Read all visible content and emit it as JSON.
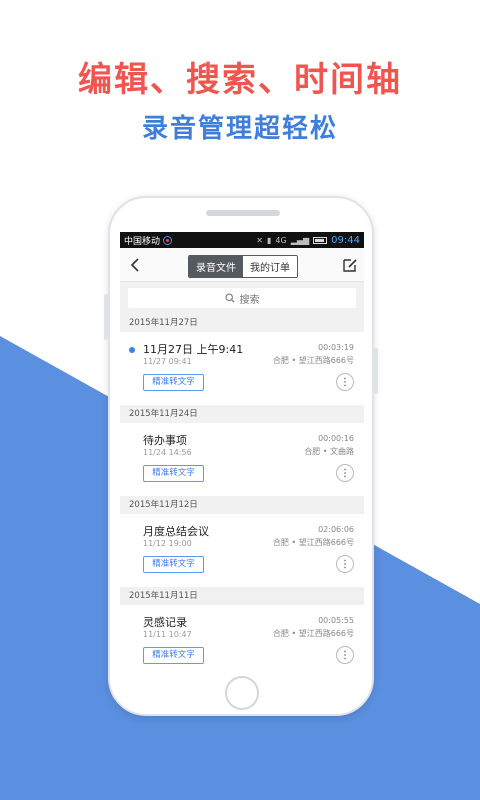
{
  "promo": {
    "headline": "编辑、搜索、时间轴",
    "subline": "录音管理超轻松"
  },
  "colors": {
    "headline": "#f0564f",
    "subline": "#3f7fdc",
    "background_triangle": "#5b8fdf",
    "accent": "#3b82f6"
  },
  "statusbar": {
    "carrier": "中国移动",
    "network": "4G",
    "time": "09:44"
  },
  "navbar": {
    "back_icon": "chevron-left-icon",
    "tabs": [
      {
        "label": "录音文件",
        "active": true
      },
      {
        "label": "我的订单",
        "active": false
      }
    ],
    "edit_icon": "edit-icon"
  },
  "search": {
    "placeholder": "搜索"
  },
  "groups": [
    {
      "date": "2015年11月27日",
      "items": [
        {
          "title": "11月27日 上午9:41",
          "meta": "11/27  09:41",
          "duration": "00:03:19",
          "location": "合肥 • 望江西路666号",
          "button": "精准转文字",
          "new": true
        }
      ]
    },
    {
      "date": "2015年11月24日",
      "items": [
        {
          "title": "待办事项",
          "meta": "11/24  14:56",
          "duration": "00:00:16",
          "location": "合肥 • 文曲路",
          "button": "精准转文字",
          "new": false
        }
      ]
    },
    {
      "date": "2015年11月12日",
      "items": [
        {
          "title": "月度总结会议",
          "meta": "11/12  19:00",
          "duration": "02:06:06",
          "location": "合肥 • 望江西路666号",
          "button": "精准转文字",
          "new": false
        }
      ]
    },
    {
      "date": "2015年11月11日",
      "items": [
        {
          "title": "灵感记录",
          "meta": "11/11  10:47",
          "duration": "00:05:55",
          "location": "合肥 • 望江西路666号",
          "button": "精准转文字",
          "new": false
        }
      ]
    }
  ]
}
